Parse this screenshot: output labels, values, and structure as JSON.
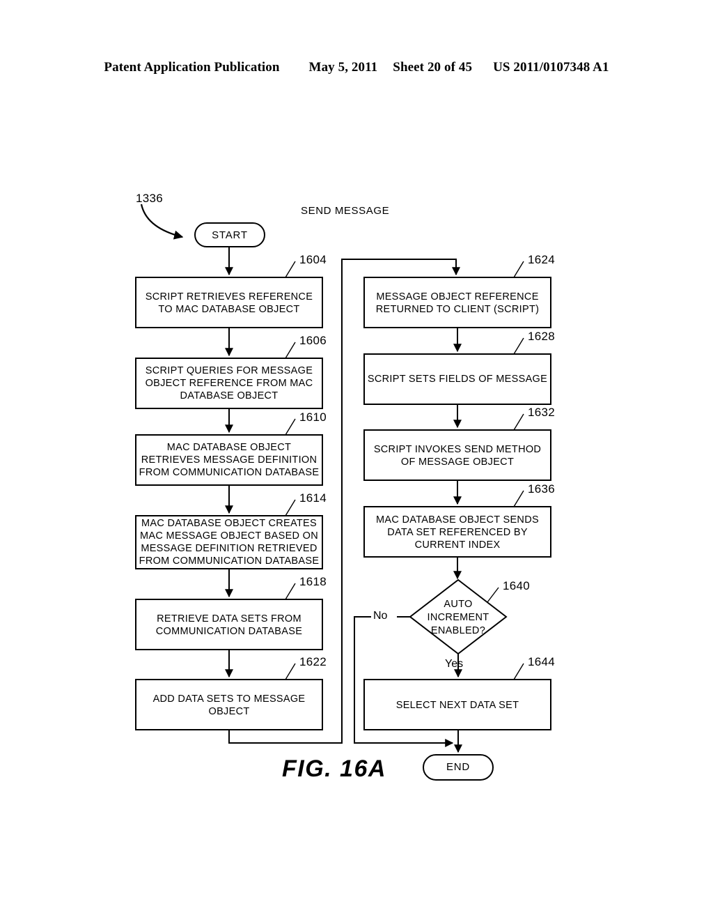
{
  "header": {
    "publication": "Patent Application Publication",
    "date": "May 5, 2011",
    "sheet": "Sheet 20 of 45",
    "patent_number": "US 2011/0107348 A1"
  },
  "figure": {
    "caption": "FIG. 16A",
    "title": "SEND MESSAGE",
    "root_ref": "1336",
    "start_label": "START",
    "end_label": "END",
    "branch_yes": "Yes",
    "branch_no": "No",
    "line_color": "#000000",
    "fill_color": "#ffffff"
  },
  "nodes": {
    "n1604": {
      "ref": "1604",
      "text": "SCRIPT RETRIEVES REFERENCE\nTO MAC DATABASE OBJECT"
    },
    "n1606": {
      "ref": "1606",
      "text": "SCRIPT QUERIES FOR MESSAGE\nOBJECT REFERENCE FROM MAC\nDATABASE OBJECT"
    },
    "n1610": {
      "ref": "1610",
      "text": "MAC DATABASE OBJECT\nRETRIEVES MESSAGE DEFINITION\nFROM COMMUNICATION DATABASE"
    },
    "n1614": {
      "ref": "1614",
      "text": "MAC DATABASE OBJECT CREATES\nMAC MESSAGE OBJECT BASED ON\nMESSAGE DEFINITION RETRIEVED\nFROM COMMUNICATION DATABASE"
    },
    "n1618": {
      "ref": "1618",
      "text": "RETRIEVE DATA SETS FROM\nCOMMUNICATION DATABASE"
    },
    "n1622": {
      "ref": "1622",
      "text": "ADD DATA SETS TO MESSAGE\nOBJECT"
    },
    "n1624": {
      "ref": "1624",
      "text": "MESSAGE OBJECT REFERENCE\nRETURNED TO CLIENT (SCRIPT)"
    },
    "n1628": {
      "ref": "1628",
      "text": "SCRIPT SETS FIELDS OF MESSAGE"
    },
    "n1632": {
      "ref": "1632",
      "text": "SCRIPT INVOKES SEND METHOD\nOF MESSAGE OBJECT"
    },
    "n1636": {
      "ref": "1636",
      "text": "MAC DATABASE OBJECT SENDS\nDATA SET REFERENCED BY\nCURRENT INDEX"
    },
    "n1640": {
      "ref": "1640",
      "text": "AUTO\nINCREMENT\nENABLED?"
    },
    "n1644": {
      "ref": "1644",
      "text": "SELECT NEXT DATA SET"
    }
  }
}
